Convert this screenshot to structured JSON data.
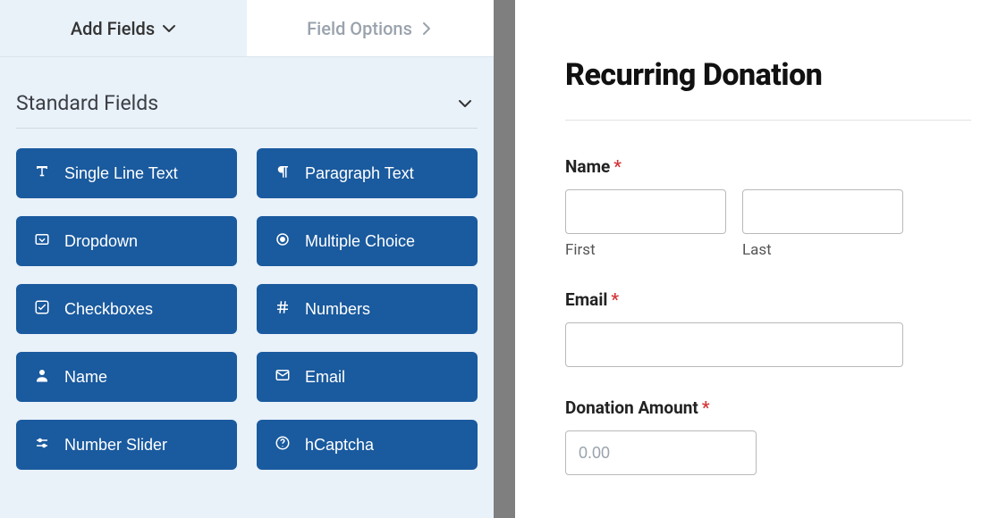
{
  "tabs": {
    "add_fields": "Add Fields",
    "field_options": "Field Options"
  },
  "section": {
    "title": "Standard Fields"
  },
  "fields": {
    "single_line_text": "Single Line Text",
    "paragraph_text": "Paragraph Text",
    "dropdown": "Dropdown",
    "multiple_choice": "Multiple Choice",
    "checkboxes": "Checkboxes",
    "numbers": "Numbers",
    "name": "Name",
    "email": "Email",
    "number_slider": "Number Slider",
    "hcaptcha": "hCaptcha"
  },
  "form": {
    "title": "Recurring Donation",
    "name_label": "Name",
    "first_sub": "First",
    "last_sub": "Last",
    "email_label": "Email",
    "donation_label": "Donation Amount",
    "donation_placeholder": "0.00",
    "required_mark": "*"
  }
}
